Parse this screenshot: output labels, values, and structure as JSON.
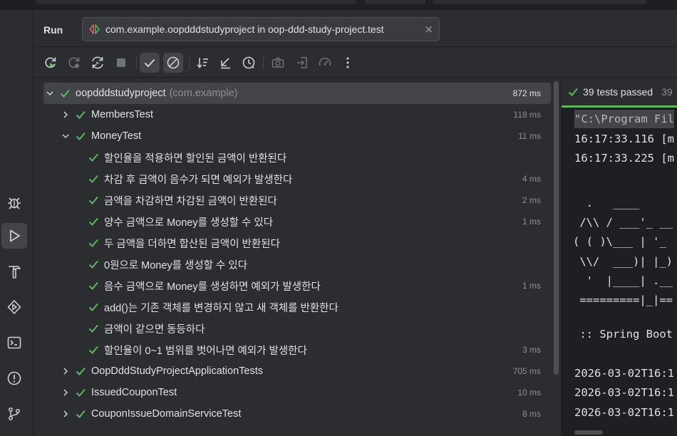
{
  "run_panel": {
    "title": "Run",
    "tab": {
      "label": "com.example.oopdddstudyproject in oop-ddd-study-project.test",
      "close": "×"
    }
  },
  "toolbar": {
    "buttons": [
      "rerun-icon",
      "rerun-failed-icon",
      "toggle-auto-test-icon",
      "stop-icon",
      "show-passed-icon",
      "show-ignored-icon",
      "sort-icon",
      "collapse-icon",
      "history-icon",
      "screenshot-icon",
      "import-icon",
      "coverage-icon",
      "more-icon"
    ]
  },
  "tree": {
    "root": {
      "label": "oopdddstudyproject",
      "package": "(com.example)",
      "time": "872 ms"
    },
    "items": [
      {
        "label": "MembersTest",
        "time": "118 ms"
      },
      {
        "label": "MoneyTest",
        "time": "11 ms"
      },
      {
        "label": "할인율을 적용하면 할인된 금액이 반환된다",
        "time": ""
      },
      {
        "label": "차감 후 금액이 음수가 되면 예외가 발생한다",
        "time": "4 ms"
      },
      {
        "label": "금액을 차감하면 차감된 금액이 반환된다",
        "time": "2 ms"
      },
      {
        "label": "양수 금액으로 Money를 생성할 수 있다",
        "time": "1 ms"
      },
      {
        "label": "두 금액을 더하면 합산된 금액이 반환된다",
        "time": ""
      },
      {
        "label": "0원으로 Money를 생성할 수 있다",
        "time": ""
      },
      {
        "label": "음수 금액으로 Money를 생성하면 예외가 발생한다",
        "time": "1 ms"
      },
      {
        "label": "add()는 기존 객체를 변경하지 않고 새 객체를 반환한다",
        "time": ""
      },
      {
        "label": "금액이 같으면 동등하다",
        "time": ""
      },
      {
        "label": "할인율이 0~1 범위를 벗어나면 예외가 발생한다",
        "time": "3 ms"
      },
      {
        "label": "OopDddStudyProjectApplicationTests",
        "time": "705 ms"
      },
      {
        "label": "IssuedCouponTest",
        "time": "10 ms"
      },
      {
        "label": "CouponIssueDomainServiceTest",
        "time": "8 ms"
      }
    ]
  },
  "console": {
    "status": "39 tests passed",
    "status_extra": "39",
    "lines": [
      "\"C:\\Program Fil",
      "16:17:33.116 [m",
      "16:17:33.225 [m",
      "",
      "  .   ____",
      " /\\\\ / ___'_ __",
      "( ( )\\___ | '_",
      " \\\\/  ___)| |_)",
      "  '  |____| .__",
      " =========|_|==",
      "",
      " :: Spring Boot",
      "",
      "2026-03-02T16:1",
      "2026-03-02T16:1",
      "2026-03-02T16:1"
    ]
  },
  "colors": {
    "pass": "#5fb85c",
    "accent_panel": "#2b2d30",
    "console_bg": "#1e1f22"
  }
}
